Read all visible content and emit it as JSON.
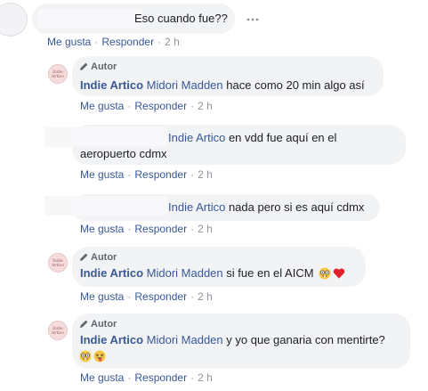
{
  "actions": {
    "like": "Me gusta",
    "reply": "Responder",
    "time": "2 h"
  },
  "author_badge": {
    "label": "Autor",
    "icon": "pencil-icon"
  },
  "page_avatar_text": "Indie Artico",
  "top_comment": {
    "text": "Eso cuando fue??",
    "more_icon": "more-options-icon"
  },
  "comments": [
    {
      "author": "Indie Artico",
      "mention": "Midori Madden",
      "text": "hace como 20 min algo así"
    },
    {
      "mention": "Indie Artico",
      "text_line1": "en vdd fue aquí en el",
      "text_line2": "aeropuerto cdmx"
    },
    {
      "mention": "Indie Artico",
      "text": "nada pero si es aquí cdmx"
    },
    {
      "author": "Indie Artico",
      "mention": "Midori Madden",
      "text": "si fue en el AICM",
      "emojis": [
        "nerd-face-icon",
        "red-heart-icon"
      ]
    },
    {
      "author": "Indie Artico",
      "mention": "Midori Madden",
      "text": "y yo que ganaria con mentirte?",
      "emojis": [
        "nerd-face-icon",
        "winking-tongue-face-icon"
      ]
    }
  ]
}
